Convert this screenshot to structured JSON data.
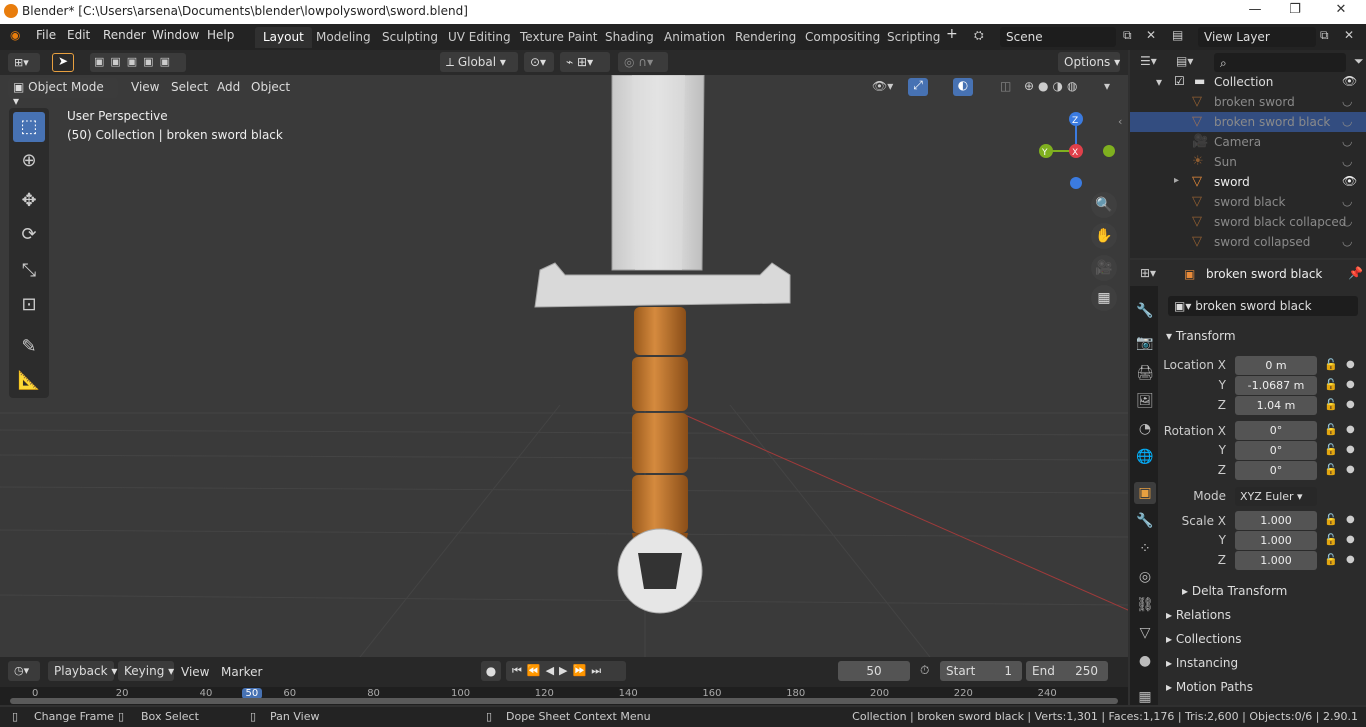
{
  "window": {
    "title": "Blender* [C:\\Users\\arsena\\Documents\\blender\\lowpolysword\\sword.blend]",
    "minimize": "—",
    "maximize": "❐",
    "close": "✕"
  },
  "menu": [
    "File",
    "Edit",
    "Render",
    "Window",
    "Help"
  ],
  "workspaces": [
    "Layout",
    "Modeling",
    "Sculpting",
    "UV Editing",
    "Texture Paint",
    "Shading",
    "Animation",
    "Rendering",
    "Compositing",
    "Scripting"
  ],
  "active_workspace": "Layout",
  "scene": "Scene",
  "view_layer": "View Layer",
  "toolheader": {
    "orientation": "Global",
    "options": "Options"
  },
  "viewport_header": {
    "mode": "Object Mode",
    "menus": [
      "View",
      "Select",
      "Add",
      "Object"
    ]
  },
  "viewport_overlay": {
    "line1": "User Perspective",
    "line2": "(50) Collection | broken sword black"
  },
  "gizmo_axes": {
    "x": "X",
    "y": "Y",
    "z": "Z"
  },
  "outliner": {
    "collection": "Collection",
    "items": [
      {
        "label": "broken sword",
        "type": "mesh",
        "dim": true
      },
      {
        "label": "broken sword black",
        "type": "mesh",
        "dim": true,
        "selected": true
      },
      {
        "label": "Camera",
        "type": "camera",
        "dim": true
      },
      {
        "label": "Sun",
        "type": "light",
        "dim": true
      },
      {
        "label": "sword",
        "type": "mesh",
        "dim": false
      },
      {
        "label": "sword black",
        "type": "mesh",
        "dim": true
      },
      {
        "label": "sword black collapced",
        "type": "mesh",
        "dim": true
      },
      {
        "label": "sword collapsed",
        "type": "mesh",
        "dim": true
      }
    ]
  },
  "properties": {
    "object_name": "broken sword black",
    "name_field": "broken sword black",
    "transform_label": "Transform",
    "location_label": "Location X",
    "location": [
      "0 m",
      "-1.0687 m",
      "1.04 m"
    ],
    "rotation_label": "Rotation X",
    "rotation": [
      "0°",
      "0°",
      "0°"
    ],
    "mode_label": "Mode",
    "mode": "XYZ Euler",
    "scale_label": "Scale X",
    "scale": [
      "1.000",
      "1.000",
      "1.000"
    ],
    "axis_y": "Y",
    "axis_z": "Z",
    "delta": "Delta Transform",
    "sections": [
      "Relations",
      "Collections",
      "Instancing",
      "Motion Paths"
    ]
  },
  "timeline": {
    "menus": [
      "Playback",
      "Keying",
      "View",
      "Marker"
    ],
    "current_frame": "50",
    "start_label": "Start",
    "start": "1",
    "end_label": "End",
    "end": "250",
    "ticks": [
      "0",
      "20",
      "40",
      "50",
      "60",
      "80",
      "100",
      "120",
      "140",
      "160",
      "180",
      "200",
      "220",
      "240"
    ]
  },
  "statusbar": {
    "left": [
      "Change Frame",
      "Box Select",
      "Pan View",
      "Dope Sheet Context Menu"
    ],
    "right": "Collection | broken sword black | Verts:1,301 | Faces:1,176 | Tris:2,600 | Objects:0/6 | 2.90.1"
  },
  "colors": {
    "accent": "#4772b3",
    "object_orange": "#e88b3a",
    "x_axis": "#e0404a",
    "y_axis": "#7fb01f",
    "z_axis": "#3b7be0"
  }
}
